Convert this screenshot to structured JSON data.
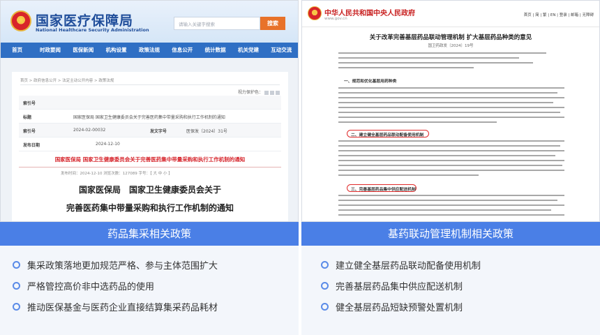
{
  "left": {
    "site_title": "国家医疗保障局",
    "site_title_en": "National Healthcare Security Administration",
    "search_placeholder": "请输入关键字搜索",
    "search_button": "搜索",
    "nav": [
      "首页",
      "时政要闻",
      "医保新闻",
      "机构设置",
      "政策法规",
      "信息公开",
      "统计数据",
      "机关党建",
      "互动交流"
    ],
    "breadcrumb": "首页 > 政府信息公开 > 法定主动公开内容 > 政策法规",
    "view_size": "视力保护色：",
    "meta": [
      {
        "label": "索引号",
        "value": "",
        "label2": "",
        "value2": ""
      },
      {
        "label": "标题",
        "value": "国家医保局 国家卫生健康委员会关于完善医药集中带量采购和执行工作机制的通知",
        "label2": "",
        "value2": ""
      },
      {
        "label": "索引号",
        "value": "2024-02-00032",
        "label2": "发文字号",
        "value2": "医保发〔2024〕31号"
      },
      {
        "label": "发布日期",
        "value": "2024-12-10",
        "label2": "",
        "value2": ""
      }
    ],
    "red_title": "国家医保局 国家卫生健康委员会关于完善医药集中带量采购和执行工作机制的通知",
    "date_line": "发布时间：2024-12-10    浏览次数：127089    字号：【 大 中 小 】",
    "doc_title_1": "国家医保局　国家卫生健康委员会关于",
    "doc_title_2": "完善医药集中带量采购和执行工作机制的通知",
    "card_title": "药品集采相关政策",
    "items": [
      "集采政策落地更加规范严格、参与主体范围扩大",
      "严格管控高价非中选药品的使用",
      "推动医保基金与医药企业直接结算集采药品耗材"
    ]
  },
  "right": {
    "site_title": "中华人民共和国中央人民政府",
    "site_url": "www.gov.cn",
    "top_links": "首页 | 简 | 繁 | EN | 登录 | 邮箱 | 无障碍",
    "doc_title": "关于改革完善基层药品联动管理机制 扩大基层药品种类的意见",
    "doc_no": "国卫药政发〔2024〕19号",
    "section_1": "一、规范和优化基层用药种类",
    "box_1": "二、建立健全基层药品联动配备使用机制",
    "box_2": "三、完善基层药品集中供应配送机制",
    "card_title": "基药联动管理机制相关政策",
    "items": [
      "建立健全基层药品联动配备使用机制",
      "完善基层药品集中供应配送机制",
      "健全基层药品短缺预警处置机制"
    ]
  },
  "colors": {
    "accent": "#4a7fe6",
    "card_bg": "#f3f6fb",
    "ring": "#5a8be8",
    "red": "#d6242b"
  }
}
